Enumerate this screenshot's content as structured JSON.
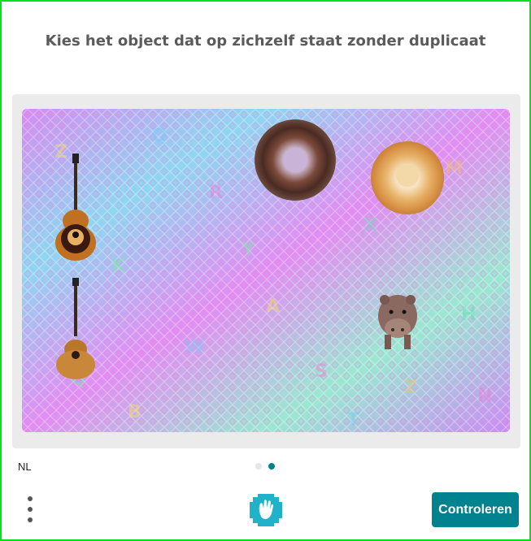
{
  "prompt": "Kies het object dat op zichzelf staat zonder duplicaat",
  "language": "NL",
  "submit_label": "Controleren",
  "pagination": {
    "count": 2,
    "active_index": 1
  },
  "colors": {
    "accent": "#00838f",
    "frame_border": "#00e21a",
    "panel_bg": "#ebebeb",
    "prompt_text": "#5b5b5b"
  },
  "challenge_objects": [
    {
      "name": "guitar",
      "occurrences": 2
    },
    {
      "name": "donut",
      "occurrences": 2
    },
    {
      "name": "hippo",
      "occurrences": 1
    }
  ],
  "icons": {
    "menu": "vertical-dots-icon",
    "logo": "hand-logo-icon"
  }
}
